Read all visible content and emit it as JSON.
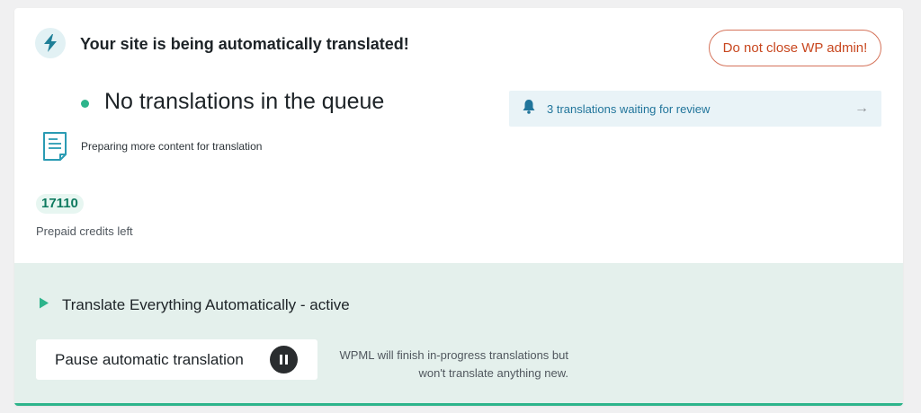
{
  "header": {
    "title": "Your site is being automatically translated!",
    "icon": "lightning-icon",
    "warning_button": "Do not close WP admin!"
  },
  "queue": {
    "status": "No translations in the queue",
    "status_color": "#2db48b",
    "preparing": "Preparing more content for translation",
    "preparing_icon": "document-icon"
  },
  "review": {
    "icon": "bell-icon",
    "text": "3 translations waiting for review",
    "arrow": "→"
  },
  "credits": {
    "value": "17110",
    "label": "Prepaid credits left"
  },
  "automatic": {
    "icon": "play-icon",
    "title": "Translate Everything Automatically - active",
    "pause_button": "Pause automatic translation",
    "pause_icon": "pause-icon",
    "note_line1": "WPML will finish in-progress translations but",
    "note_line2": "won't translate anything new."
  },
  "colors": {
    "accent": "#2db48b",
    "warning": "#c8471f",
    "link": "#21759b",
    "panel_bg": "#e4f0ec"
  }
}
